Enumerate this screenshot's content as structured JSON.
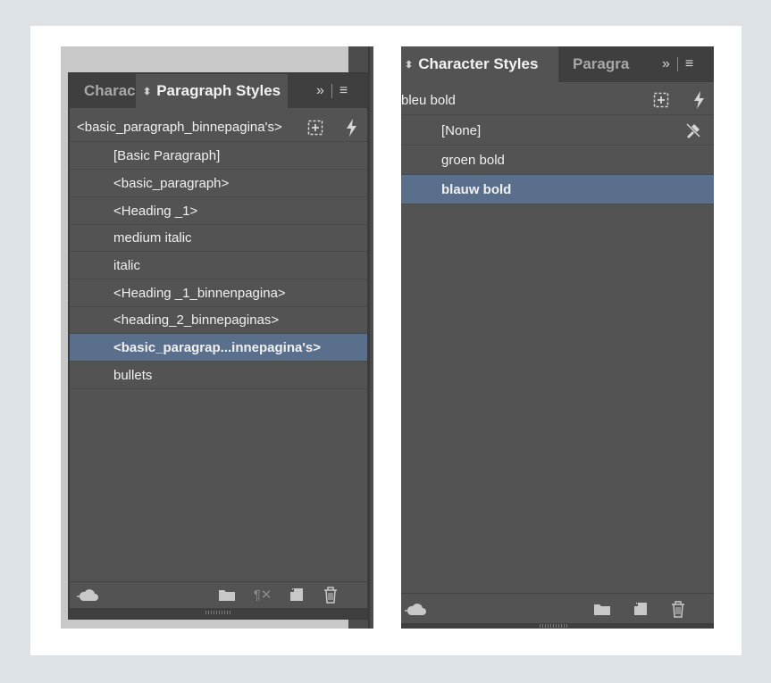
{
  "left_panel": {
    "tabs": [
      {
        "label": "Charac",
        "active": false
      },
      {
        "label": "Paragraph Styles",
        "active": true
      }
    ],
    "current_style": "<basic_paragraph_binnepagina's>",
    "styles": [
      "[Basic Paragraph]",
      "<basic_paragraph>",
      "<Heading _1>",
      "medium italic",
      "italic",
      "<Heading _1_binnenpagina>",
      "<heading_2_binnepaginas>",
      "<basic_paragrap...innepagina's>",
      "bullets"
    ],
    "selected_index": 7,
    "footer_icons": [
      "cloud-sync-icon",
      "folder-icon",
      "clear-overrides-icon",
      "new-style-icon",
      "trash-icon"
    ]
  },
  "right_panel": {
    "tabs": [
      {
        "label": "Character Styles",
        "active": true
      },
      {
        "label": "Paragra",
        "active": false
      }
    ],
    "current_style": "bleu bold",
    "styles": [
      "[None]",
      "groen bold",
      "blauw bold"
    ],
    "selected_index": 2,
    "footer_icons": [
      "cloud-sync-icon",
      "folder-icon",
      "new-style-icon",
      "trash-icon"
    ]
  },
  "colors": {
    "panel_bg": "#535353",
    "tabbar_bg": "#3f3f3f",
    "selection": "#5a6f8c",
    "text": "#f0f0f0"
  }
}
